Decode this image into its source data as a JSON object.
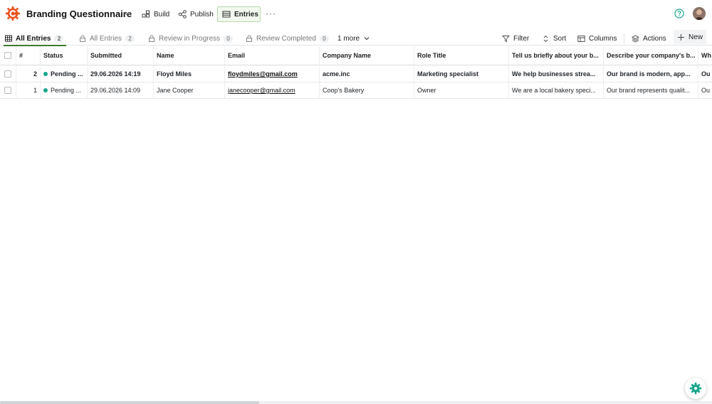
{
  "app": {
    "title": "Branding Questionnaire",
    "brand_color": "#e8521c",
    "accent_color": "#3f7a2f"
  },
  "nav": {
    "build": "Build",
    "publish": "Publish",
    "entries": "Entries",
    "more": "···"
  },
  "tabs": [
    {
      "label": "All Entries",
      "count": "2",
      "icon": "grid-icon",
      "active": true
    },
    {
      "label": "All Entries",
      "count": "2",
      "icon": "lock-icon"
    },
    {
      "label": "Review in Progress",
      "count": "0",
      "icon": "lock-icon"
    },
    {
      "label": "Review Completed",
      "count": "0",
      "icon": "lock-icon"
    }
  ],
  "more_tabs": "1 more",
  "toolbar": {
    "filter": "Filter",
    "sort": "Sort",
    "columns": "Columns",
    "actions": "Actions",
    "new": "New"
  },
  "table": {
    "headers": {
      "num": "#",
      "status": "Status",
      "submitted": "Submitted",
      "name": "Name",
      "email": "Email",
      "company": "Company Name",
      "role": "Role Title",
      "tell": "Tell us briefly about your b...",
      "describe": "Describe your company's b...",
      "wh": "Wh"
    },
    "rows": [
      {
        "num": "2",
        "status": "Pending ...",
        "status_color": "#1aa58e",
        "submitted": "29.06.2026 14:19",
        "name": "Floyd Miles",
        "email": "floydmiles@gmail.com",
        "company": "acme.inc",
        "role": "Marketing specialist",
        "tell": "We help businesses strea...",
        "describe": "Our brand is modern, app...",
        "wh": "Ou"
      },
      {
        "num": "1",
        "status": "Pending ...",
        "status_color": "#1aa58e",
        "submitted": "29.06.2026 14:09",
        "name": "Jane Cooper",
        "email": "janecooper@gmail.com",
        "company": "Coop's Bakery",
        "role": "Owner",
        "tell": "We are a local bakery speci...",
        "describe": "Our brand represents qualit...",
        "wh": "Ou"
      }
    ]
  }
}
